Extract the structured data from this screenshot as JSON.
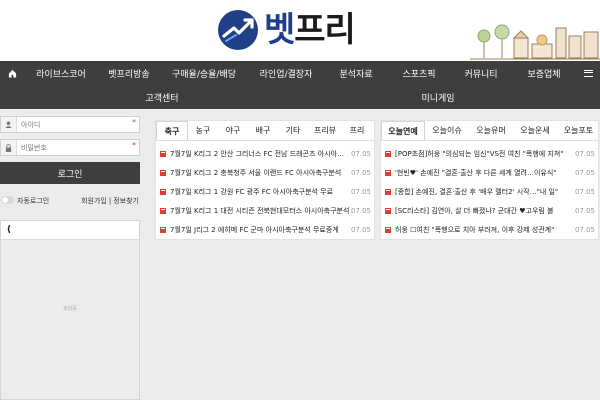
{
  "logo": {
    "text_a": "벳",
    "text_b": "프리"
  },
  "nav": {
    "row1": [
      "라이브스코어",
      "벳프리방송",
      "구매율/승율/배당",
      "라인업/결장자",
      "분석자료",
      "스포츠픽",
      "커뮤니티",
      "보증업체"
    ],
    "row2": [
      "고객센터",
      "미니게임"
    ]
  },
  "login": {
    "id_placeholder": "아이디",
    "pw_placeholder": "비밀번호",
    "button": "로그인",
    "auto_login": "자동로그인",
    "join": "회원가입",
    "separator": "|",
    "find": "정보찾기"
  },
  "side_box": {
    "header": "(",
    "loading": "로딩중"
  },
  "left_panel": {
    "tabs": [
      "축구",
      "농구",
      "야구",
      "배구",
      "기타",
      "프리뷰",
      "프리"
    ],
    "items": [
      {
        "title": "7월7일 K리그 2 안산 그리너스 FC 전남 드래곤즈 아시아축구분석",
        "date": "07.05"
      },
      {
        "title": "7월7일 K리그 2 충북청주 서울 이랜드 FC 아시아축구분석",
        "date": "07.05"
      },
      {
        "title": "7월7일 K리그 1 강원 FC 광주 FC 아시아축구분석 무료",
        "date": "07.05"
      },
      {
        "title": "7월7일 K리그 1 대전 시티즌 전북현대모터스 아시아축구분석",
        "date": "07.05"
      },
      {
        "title": "7월7일 J리그 2 에히메 FC 군마 아시아축구분석 무료중계",
        "date": "07.05"
      }
    ]
  },
  "right_panel": {
    "tabs": [
      "오늘연예",
      "오늘이슈",
      "오늘유머",
      "오늘운세",
      "오늘포토"
    ],
    "items": [
      {
        "title": "[POP초점]허웅 \"의심되는 임신\"VS전 여친 \"폭행에 지쳐\"",
        "date": "07.05"
      },
      {
        "title": "'현빈♥' 손예진 \"결혼·출산 후 다른 세계 열려…이유식\"",
        "date": "07.05"
      },
      {
        "title": "[종합] 손예진, 결혼·출산 후 '배우 멜터2' 시작…\"내 일\"",
        "date": "07.05"
      },
      {
        "title": "[SC리스타] 김연아, 살 더 빠졌나? 군대간 ♥고우림 볼",
        "date": "07.05"
      },
      {
        "title": "허웅 ☐여친 \"폭행으로 치아 부러져, 이후 강제 성관계\"",
        "date": "07.05"
      }
    ]
  },
  "colors": {
    "nav_bg": "#3e3e3e",
    "accent_red": "#e53935",
    "logo_blue": "#1e3d8c"
  },
  "icons": {
    "home": "home-icon",
    "menu": "hamburger-menu-icon",
    "user": "user-icon",
    "lock": "lock-icon",
    "bullet": "red-square-bullet-icon"
  }
}
